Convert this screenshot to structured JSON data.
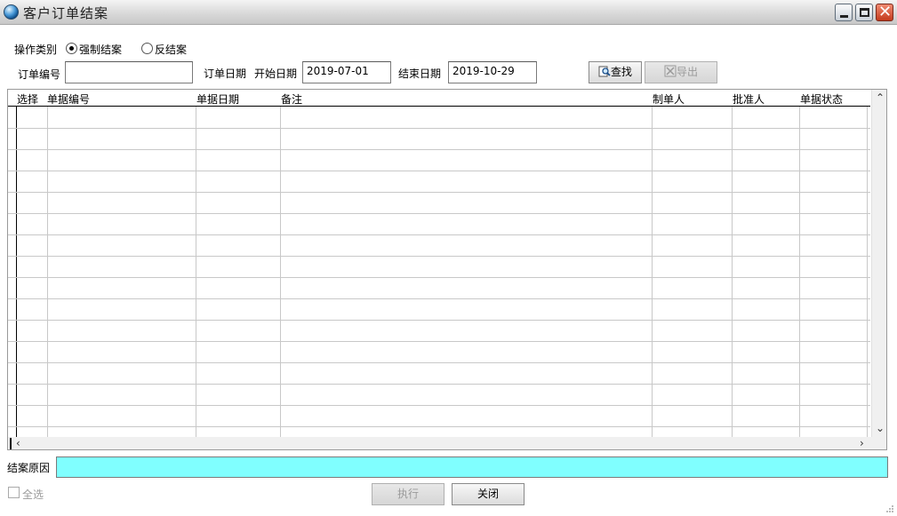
{
  "window": {
    "title": "客户订单结案"
  },
  "filters": {
    "operation_label": "操作类别",
    "option_force": "强制结案",
    "option_reverse": "反结案",
    "order_no_label": "订单编号",
    "order_no_value": "",
    "order_date_label": "订单日期",
    "start_date_label": "开始日期",
    "start_date_value": "2019-07-01",
    "end_date_label": "结束日期",
    "end_date_value": "2019-10-29",
    "search_label": "查找",
    "export_label": "导出"
  },
  "grid": {
    "columns": [
      "选择",
      "单据编号",
      "单据日期",
      "备注",
      "制单人",
      "批准人",
      "单据状态"
    ],
    "rows": []
  },
  "footer": {
    "reason_label": "结案原因",
    "reason_value": "",
    "select_all_label": "全选",
    "execute_label": "执行",
    "close_label": "关闭"
  },
  "icons": {
    "app": "globe-icon",
    "search": "search-icon",
    "export": "export-icon"
  },
  "colors": {
    "reason_field_bg": "#80ffff"
  }
}
